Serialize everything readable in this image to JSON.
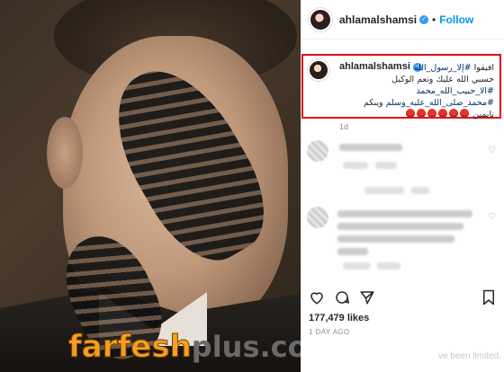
{
  "post": {
    "username": "ahlamalshamsi",
    "follow_label": "Follow",
    "dot": "•",
    "verified_mark": "✓"
  },
  "caption": {
    "username": "ahlamalshamsi",
    "line1_text": "افيقوا",
    "line1_hash": "#إلا_رسول_الله",
    "line2": "حسبي الله عليك ونعم الوكيل",
    "line3_hash": "#الا_حبيب_الله_محمد",
    "line4_hash": "#محمد_صلى_الله_عليه_وسلم",
    "line4_text": "وينكم",
    "line5_text": "نايمين",
    "emoji_count": 6,
    "emoji_name": "angry-face",
    "time": "1d"
  },
  "actions": {
    "like_icon": "heart-icon",
    "comment_icon": "comment-icon",
    "share_icon": "share-icon",
    "save_icon": "bookmark-icon"
  },
  "stats": {
    "likes": "177,479 likes",
    "date": "1 DAY AGO",
    "limited_notice": "ve been limited."
  },
  "watermark": {
    "part1": "farfesh",
    "part2": "plus.com"
  },
  "colors": {
    "accent": "#0095f6",
    "highlight_border": "#e0111a",
    "hashtag": "#00376b",
    "watermark": "#f3a020"
  }
}
